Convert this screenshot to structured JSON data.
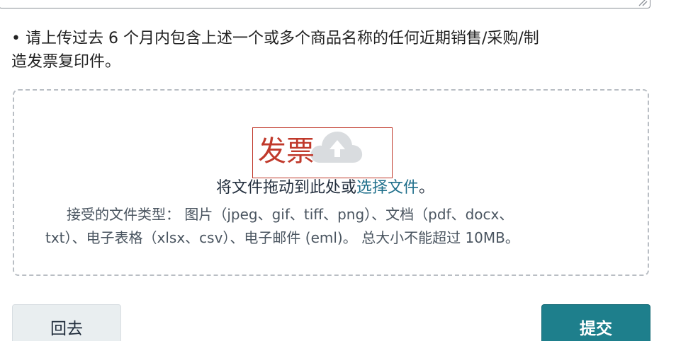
{
  "instruction": {
    "line1": "• 请上传过去 6 个月内包含上述一个或多个商品名称的任何近期销售/采购/制",
    "line2": "造发票复印件。"
  },
  "dropzone": {
    "drag_text_before": "将文件拖动到此处或",
    "select_link": "选择文件",
    "drag_text_after": "。",
    "types_line1": "接受的文件类型： 图片（jpeg、gif、tiff、png）、文档（pdf、docx、",
    "types_line2": "txt）、电子表格（xlsx、csv）、电子邮件 (eml)。 总大小不能超过 10MB。",
    "icon": "cloud-upload-icon"
  },
  "annotation": {
    "text": "发票",
    "color": "#c0392b"
  },
  "buttons": {
    "back_label": "回去",
    "submit_label": "提交"
  },
  "colors": {
    "accent": "#1e7f8c",
    "link": "#1f6f8b"
  }
}
